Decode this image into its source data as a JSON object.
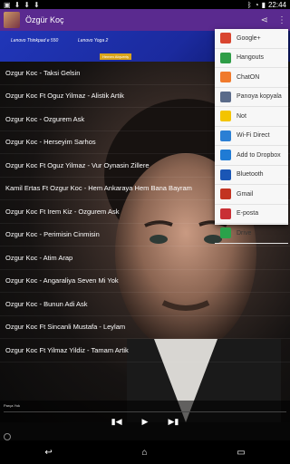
{
  "statusbar": {
    "time": "22:44",
    "left_icons": [
      "app-notification-icon",
      "download-icon",
      "download-icon",
      "download-icon"
    ],
    "right_icons": [
      "bluetooth-icon",
      "wifi-icon",
      "battery-icon"
    ]
  },
  "appbar": {
    "title": "Özgür Koç",
    "actions": [
      "share-icon",
      "overflow-icon"
    ]
  },
  "banner": {
    "left_text": "Lenovo Thinkpad e 550",
    "right_text": "Lenovo Yoga 2",
    "badge": "Hemen Alışveriş"
  },
  "songs": [
    {
      "title": "Ozgur Koc - Taksi Gelsin"
    },
    {
      "title": "Ozgur Koc Ft Oguz Yilmaz - Alistik Artik"
    },
    {
      "title": "Ozgur Koc - Ozgurem Ask"
    },
    {
      "title": "Ozgur Koc - Herseyim Sarhos"
    },
    {
      "title": "Ozgur Koc Ft Oguz Yilmaz - Vur Oynasin Zillere"
    },
    {
      "title": "Kamil Ertas Ft Ozgur Koc - Hem Ankaraya Hem Bana Bayram"
    },
    {
      "title": "Ozgur Koc Ft Irem Kiz - Ozgurem Ask"
    },
    {
      "title": "Ozgur Koc - Perimisin Cinmisin"
    },
    {
      "title": "Ozgur Koc - Atim Arap"
    },
    {
      "title": "Ozgur Koc - Angaraliya Seven Mi Yok"
    },
    {
      "title": "Ozgur Koc - Bunun Adi Ask"
    },
    {
      "title": "Ozgur Koc Ft Sincanli Mustafa - Leylam"
    },
    {
      "title": "Ozgur Koc Ft Yilmaz Yildiz - Tamam Artik"
    }
  ],
  "player": {
    "label": "Parça Yok",
    "controls": [
      "previous-icon",
      "play-icon",
      "next-icon"
    ]
  },
  "share_menu": {
    "items": [
      {
        "label": "Google+",
        "color": "#d9452f"
      },
      {
        "label": "Hangouts",
        "color": "#2e9d47"
      },
      {
        "label": "ChatON",
        "color": "#f07a2c"
      },
      {
        "label": "Panoya kopyala",
        "color": "#5a6b8a"
      },
      {
        "label": "Not",
        "color": "#f3c400"
      },
      {
        "label": "Wi-Fi Direct",
        "color": "#2b7fd4"
      },
      {
        "label": "Add to Dropbox",
        "color": "#1f7bd5"
      },
      {
        "label": "Bluetooth",
        "color": "#1a56b5"
      },
      {
        "label": "Gmail",
        "color": "#c23321"
      },
      {
        "label": "E-posta",
        "color": "#c93035"
      },
      {
        "label": "Drive",
        "color": "#2aa24a"
      }
    ]
  },
  "navbar": {
    "icons": [
      "back-icon",
      "home-icon",
      "recents-icon"
    ]
  }
}
